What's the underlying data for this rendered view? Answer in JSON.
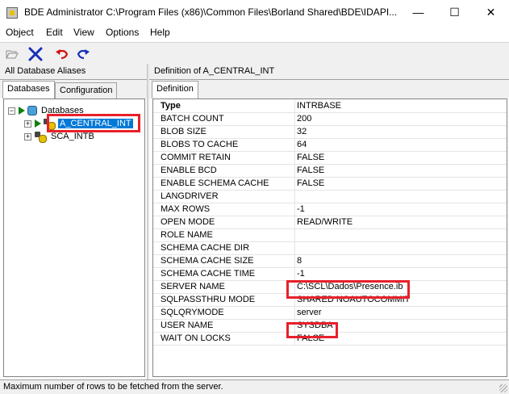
{
  "window": {
    "title": "BDE Administrator  C:\\Program Files (x86)\\Common Files\\Borland Shared\\BDE\\IDAPI...",
    "minimize": "—",
    "maximize": "☐",
    "close": "✕"
  },
  "menu": [
    "Object",
    "Edit",
    "View",
    "Options",
    "Help"
  ],
  "toolbar": [
    "open-icon",
    "delete-icon",
    "undo-icon",
    "redo-icon"
  ],
  "left_panel": {
    "header": "All Database Aliases",
    "tabs": [
      "Databases",
      "Configuration"
    ],
    "tree": {
      "root": "Databases",
      "items": [
        "A_CENTRAL_INT",
        "SCA_INTB"
      ]
    }
  },
  "right_panel": {
    "header": "Definition of A_CENTRAL_INT",
    "tab": "Definition",
    "rows": [
      {
        "key": "Type",
        "value": "INTRBASE"
      },
      {
        "key": "BATCH COUNT",
        "value": "200"
      },
      {
        "key": "BLOB SIZE",
        "value": "32"
      },
      {
        "key": "BLOBS TO CACHE",
        "value": "64"
      },
      {
        "key": "COMMIT RETAIN",
        "value": "FALSE"
      },
      {
        "key": "ENABLE BCD",
        "value": "FALSE"
      },
      {
        "key": "ENABLE SCHEMA CACHE",
        "value": "FALSE"
      },
      {
        "key": "LANGDRIVER",
        "value": ""
      },
      {
        "key": "MAX ROWS",
        "value": "-1"
      },
      {
        "key": "OPEN MODE",
        "value": "READ/WRITE"
      },
      {
        "key": "ROLE NAME",
        "value": ""
      },
      {
        "key": "SCHEMA CACHE DIR",
        "value": ""
      },
      {
        "key": "SCHEMA CACHE SIZE",
        "value": "8"
      },
      {
        "key": "SCHEMA CACHE TIME",
        "value": "-1"
      },
      {
        "key": "SERVER NAME",
        "value": "C:\\SCL\\Dados\\Presence.ib"
      },
      {
        "key": "SQLPASSTHRU MODE",
        "value": "SHARED NOAUTOCOMMIT"
      },
      {
        "key": "SQLQRYMODE",
        "value": "server"
      },
      {
        "key": "USER NAME",
        "value": "SYSDBA"
      },
      {
        "key": "WAIT ON LOCKS",
        "value": "FALSE"
      }
    ]
  },
  "status": "Maximum number of rows to be fetched from the server.",
  "colors": {
    "highlight": "#e8202a",
    "selection": "#0078d7"
  }
}
